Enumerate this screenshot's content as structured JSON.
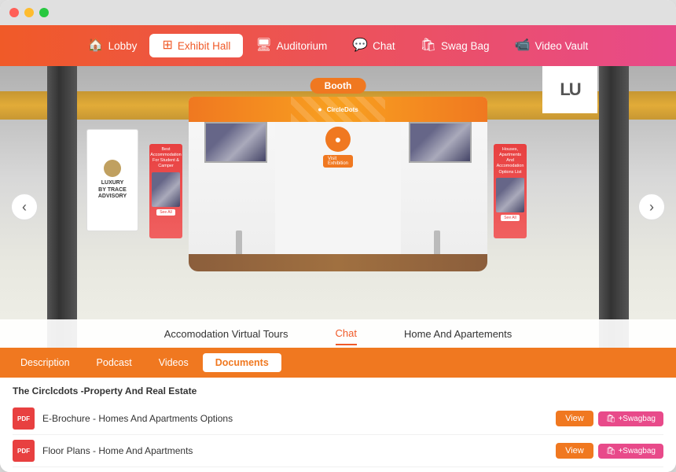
{
  "browser": {
    "dots": [
      "red",
      "yellow",
      "green"
    ]
  },
  "nav": {
    "items": [
      {
        "id": "lobby",
        "label": "Lobby",
        "icon": "🏠",
        "active": false
      },
      {
        "id": "exhibit-hall",
        "label": "Exhibit Hall",
        "icon": "⊞",
        "active": true
      },
      {
        "id": "auditorium",
        "label": "Auditorium",
        "icon": "🖥",
        "active": false
      },
      {
        "id": "chat",
        "label": "Chat",
        "icon": "💬",
        "active": false
      },
      {
        "id": "swag-bag",
        "label": "Swag Bag",
        "icon": "🛍",
        "active": false
      },
      {
        "id": "video-vault",
        "label": "Video Vault",
        "icon": "📹",
        "active": false
      }
    ]
  },
  "hall": {
    "booth_label": "Booth",
    "brand_name": "CircleDots",
    "tabs": [
      {
        "id": "accommodation",
        "label": "Accomodation Virtual Tours"
      },
      {
        "id": "chat",
        "label": "Chat"
      },
      {
        "id": "home-apartments",
        "label": "Home And Apartements"
      }
    ]
  },
  "side_banner_left": {
    "title": "LUXURY",
    "subtitle": "BY TRACE ADVISORY"
  },
  "top_right": {
    "text": "LU"
  },
  "content_tabs": {
    "tabs": [
      {
        "id": "description",
        "label": "Description",
        "active": false
      },
      {
        "id": "podcast",
        "label": "Podcast",
        "active": false
      },
      {
        "id": "videos",
        "label": "Videos",
        "active": false
      },
      {
        "id": "documents",
        "label": "Documents",
        "active": true
      }
    ]
  },
  "docs": {
    "section_title": "The Circlcdots -Property And Real Estate",
    "items": [
      {
        "id": "doc1",
        "type": "PDF",
        "name": "E-Brochure - Homes And Apartments Options",
        "view_label": "View",
        "swag_label": "+Swagbag"
      },
      {
        "id": "doc2",
        "type": "PDF",
        "name": "Floor Plans - Home And Apartments",
        "view_label": "View",
        "swag_label": "+Swagbag"
      }
    ]
  }
}
